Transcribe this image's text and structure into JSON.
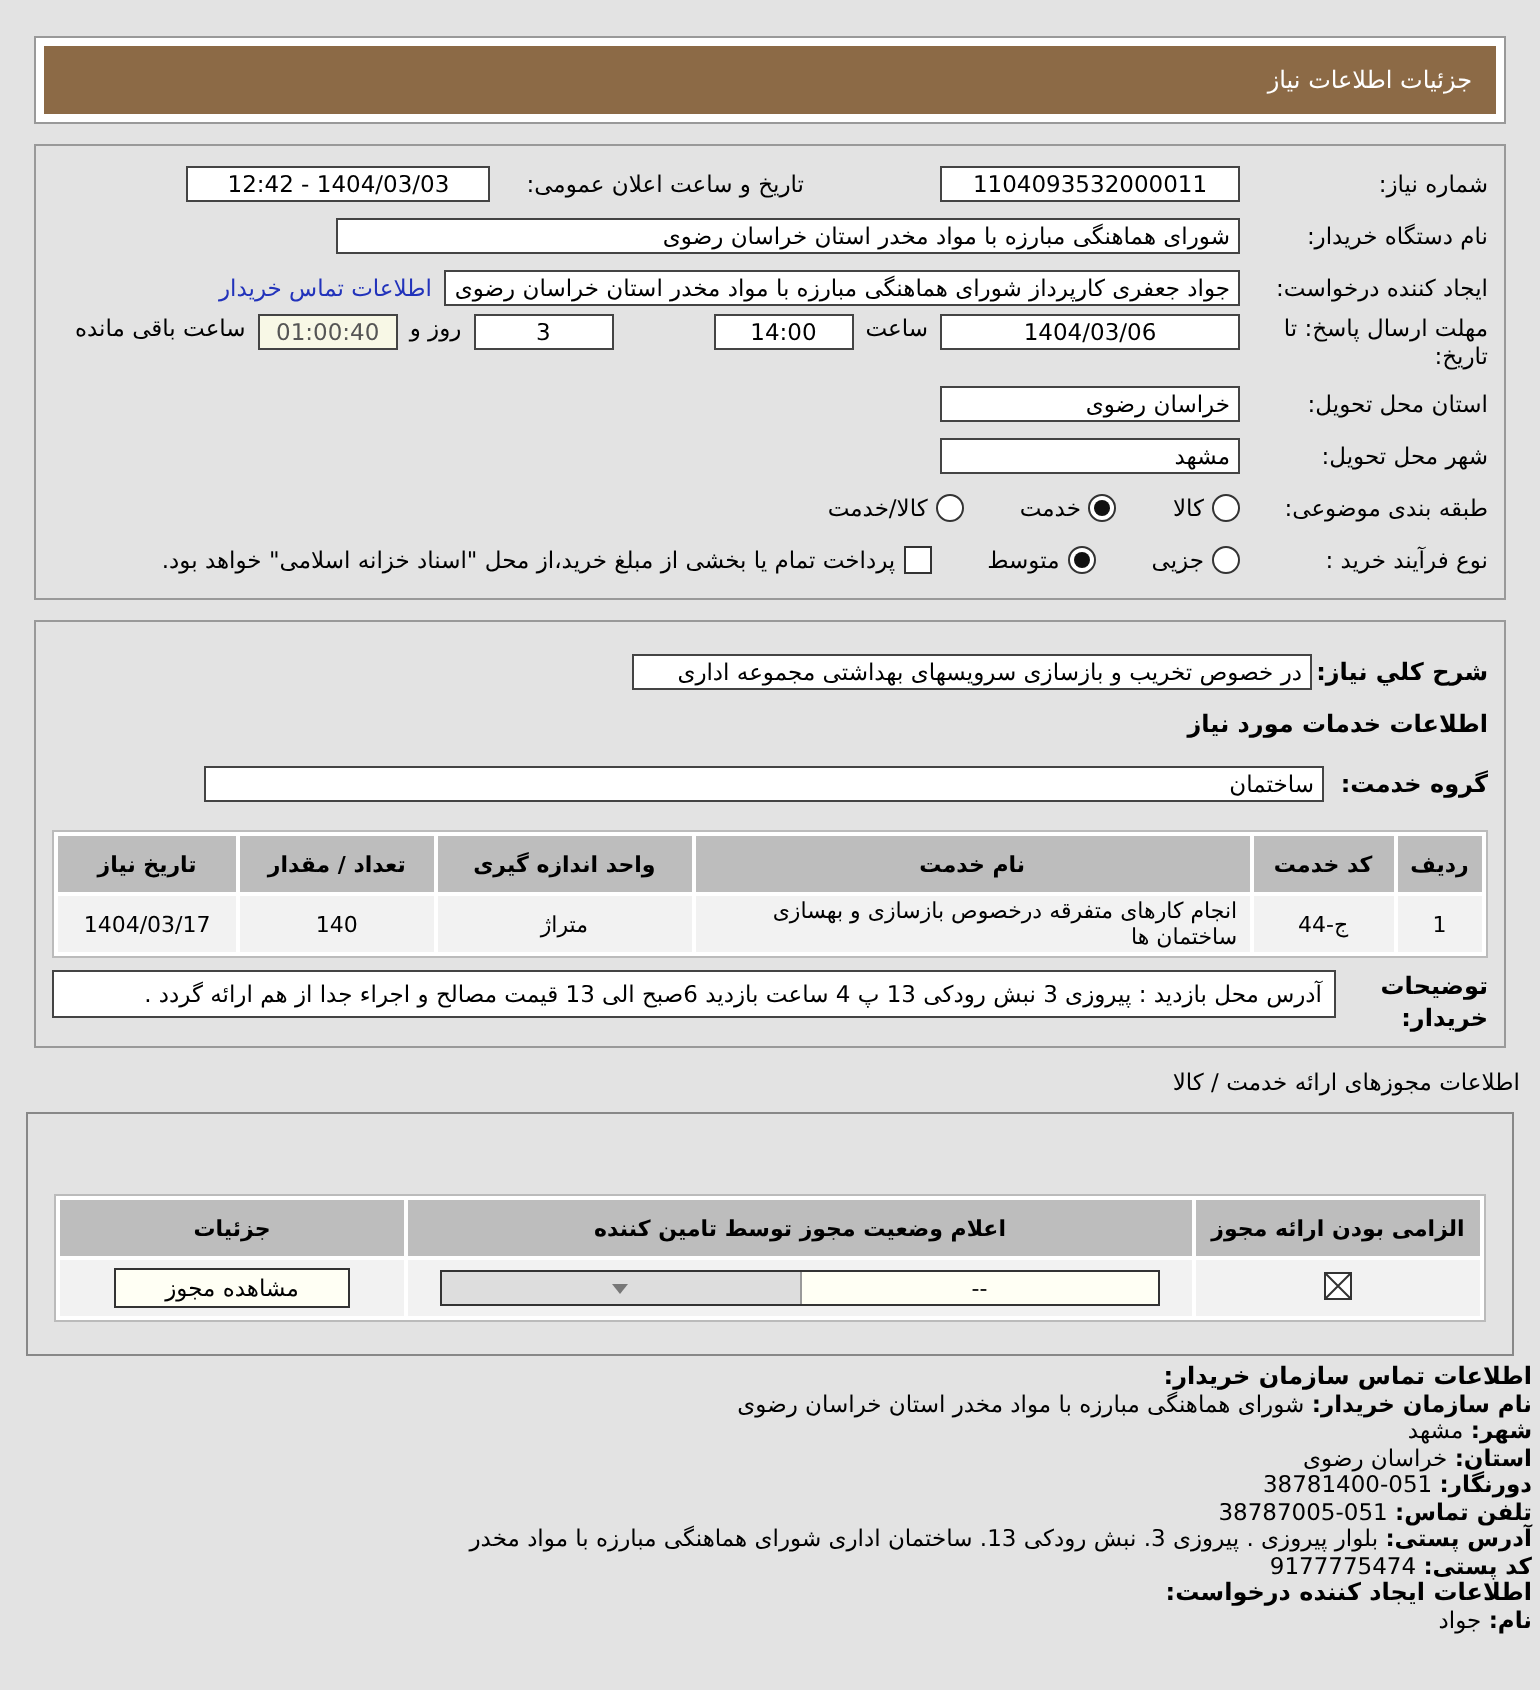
{
  "header": {
    "title": "جزئیات اطلاعات نیاز"
  },
  "need_number": {
    "label": "شماره نیاز:",
    "value": "1104093532000011"
  },
  "announce": {
    "label": "تاریخ و ساعت اعلان عمومی:",
    "value": "1404/03/03 - 12:42"
  },
  "buyer": {
    "label": "نام دستگاه خریدار:",
    "value": "شورای هماهنگی مبارزه با مواد مخدر استان خراسان رضوی"
  },
  "creator": {
    "label": "ایجاد کننده درخواست:",
    "value": "جواد جعفری کارپرداز شورای هماهنگی مبارزه با مواد مخدر استان خراسان رضوی",
    "link": "اطلاعات تماس خریدار"
  },
  "deadline": {
    "label": "مهلت ارسال پاسخ: تا تاریخ:",
    "date": "1404/03/06",
    "time_label": "ساعت",
    "time": "14:00",
    "days": "3",
    "days_label": "روز و",
    "remaining": "01:00:40",
    "remaining_label": "ساعت باقی مانده"
  },
  "province": {
    "label": "استان محل تحویل:",
    "value": "خراسان رضوی"
  },
  "city": {
    "label": "شهر محل تحویل:",
    "value": "مشهد"
  },
  "category": {
    "label": "طبقه بندی موضوعی:",
    "options": [
      {
        "label": "کالا",
        "selected": false
      },
      {
        "label": "خدمت",
        "selected": true
      },
      {
        "label": "کالا/خدمت",
        "selected": false
      }
    ]
  },
  "process": {
    "label": "نوع فرآیند خرید :",
    "options": [
      {
        "label": "جزیی",
        "selected": false
      },
      {
        "label": "متوسط",
        "selected": true
      }
    ],
    "payment": {
      "checked": false,
      "text": "پرداخت تمام یا بخشی از مبلغ خرید،از محل \"اسناد خزانه اسلامی\" خواهد بود."
    }
  },
  "description": {
    "label": "شرح کلي نياز:",
    "value": "در خصوص تخریب و بازسازی سرویسهای بهداشتی مجموعه اداری"
  },
  "services_heading": "اطلاعات خدمات مورد نیاز",
  "service_group": {
    "label": "گروه خدمت:",
    "value": "ساختمان"
  },
  "services_table": {
    "columns": [
      "ردیف",
      "کد خدمت",
      "نام خدمت",
      "واحد اندازه گیری",
      "تعداد / مقدار",
      "تاریخ نیاز"
    ],
    "rows": [
      [
        "1",
        "ج-44",
        "انجام کارهای متفرقه درخصوص بازسازی و بهسازی ساختمان ها",
        "متراژ",
        "140",
        "1404/03/17"
      ]
    ]
  },
  "buyer_notes": {
    "label": "توضیحات خریدار:",
    "value": "آدرس محل بازدید : پیروزی 3 نبش رودکی 13 پ 4 ساعت بازدید 6صبح الی 13 قیمت مصالح و اجراء جدا از هم ارائه گردد ."
  },
  "licenses": {
    "heading": "اطلاعات مجوزهای ارائه خدمت / کالا",
    "columns": [
      "الزامی بودن ارائه مجوز",
      "اعلام وضعیت مجوز توسط تامین کننده",
      "جزئیات"
    ],
    "rows": [
      {
        "required": true,
        "status": "--",
        "button": "مشاهده مجوز"
      }
    ]
  },
  "contact": [
    {
      "kind": "heading",
      "text": "اطلاعات تماس سازمان خریدار:"
    },
    {
      "kind": "field",
      "label": "نام سازمان خریدار:",
      "value": "شورای هماهنگی مبارزه با مواد مخدر استان خراسان رضوی"
    },
    {
      "kind": "field",
      "label": "شهر:",
      "value": "مشهد"
    },
    {
      "kind": "field",
      "label": "استان:",
      "value": "خراسان رضوی"
    },
    {
      "kind": "field",
      "label": "دورنگار:",
      "value": "051-38781400"
    },
    {
      "kind": "field",
      "label": "تلفن تماس:",
      "value": "051-38787005"
    },
    {
      "kind": "field",
      "label": "آدرس پستی:",
      "value": "بلوار پیروزی . پیروزی 3. نبش رودکی 13. ساختمان اداری شورای هماهنگی مبارزه با مواد مخدر"
    },
    {
      "kind": "field",
      "label": "کد پستی:",
      "value": "9177775474"
    },
    {
      "kind": "heading",
      "text": "اطلاعات ایجاد کننده درخواست:"
    },
    {
      "kind": "field",
      "label": "نام:",
      "value": "جواد"
    }
  ]
}
